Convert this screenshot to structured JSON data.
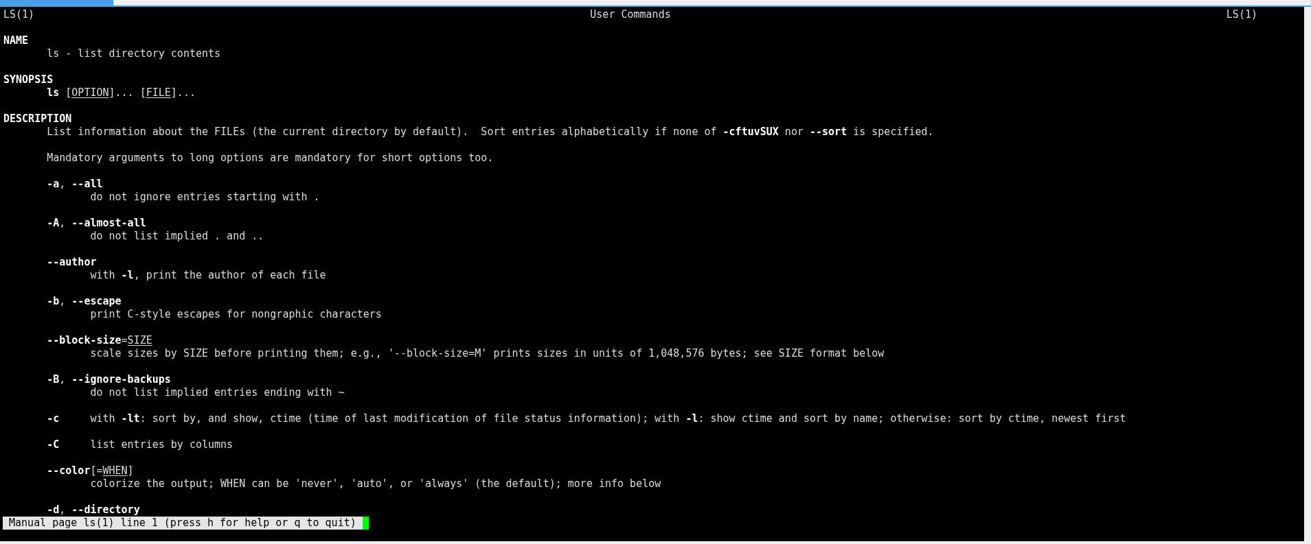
{
  "header": {
    "left": "LS(1)",
    "center": "User Commands",
    "right": "LS(1)"
  },
  "lines": [
    {
      "kind": "heading",
      "segments": [
        {
          "t": "NAME",
          "kind": "bold"
        }
      ]
    },
    {
      "kind": "text",
      "segments": [
        {
          "t": "ls - list directory contents",
          "kind": "plain"
        }
      ]
    },
    {
      "kind": "blank"
    },
    {
      "kind": "heading",
      "segments": [
        {
          "t": "SYNOPSIS",
          "kind": "bold"
        }
      ]
    },
    {
      "kind": "text",
      "segments": [
        {
          "t": "ls",
          "kind": "bold"
        },
        {
          "t": " [",
          "kind": "plain"
        },
        {
          "t": "OPTION",
          "kind": "underline"
        },
        {
          "t": "]... [",
          "kind": "plain"
        },
        {
          "t": "FILE",
          "kind": "underline"
        },
        {
          "t": "]...",
          "kind": "plain"
        }
      ]
    },
    {
      "kind": "blank"
    },
    {
      "kind": "heading",
      "segments": [
        {
          "t": "DESCRIPTION",
          "kind": "bold"
        }
      ]
    },
    {
      "kind": "text",
      "segments": [
        {
          "t": "List information about the FILEs (the current directory by default).  Sort entries alphabetically if none of ",
          "kind": "plain"
        },
        {
          "t": "-cftuvSUX",
          "kind": "bold"
        },
        {
          "t": " nor ",
          "kind": "plain"
        },
        {
          "t": "--sort",
          "kind": "bold"
        },
        {
          "t": " is specified.",
          "kind": "plain"
        }
      ]
    },
    {
      "kind": "blank"
    },
    {
      "kind": "text",
      "segments": [
        {
          "t": "Mandatory arguments to long options are mandatory for short options too.",
          "kind": "plain"
        }
      ]
    },
    {
      "kind": "blank"
    },
    {
      "kind": "text",
      "segments": [
        {
          "t": "-a",
          "kind": "bold"
        },
        {
          "t": ", ",
          "kind": "plain"
        },
        {
          "t": "--all",
          "kind": "bold"
        }
      ]
    },
    {
      "kind": "desc",
      "segments": [
        {
          "t": "do not ignore entries starting with .",
          "kind": "plain"
        }
      ]
    },
    {
      "kind": "blank"
    },
    {
      "kind": "text",
      "segments": [
        {
          "t": "-A",
          "kind": "bold"
        },
        {
          "t": ", ",
          "kind": "plain"
        },
        {
          "t": "--almost-all",
          "kind": "bold"
        }
      ]
    },
    {
      "kind": "desc",
      "segments": [
        {
          "t": "do not list implied . and ..",
          "kind": "plain"
        }
      ]
    },
    {
      "kind": "blank"
    },
    {
      "kind": "text",
      "segments": [
        {
          "t": "--author",
          "kind": "bold"
        }
      ]
    },
    {
      "kind": "desc",
      "segments": [
        {
          "t": "with ",
          "kind": "plain"
        },
        {
          "t": "-l",
          "kind": "bold"
        },
        {
          "t": ", print the author of each file",
          "kind": "plain"
        }
      ]
    },
    {
      "kind": "blank"
    },
    {
      "kind": "text",
      "segments": [
        {
          "t": "-b",
          "kind": "bold"
        },
        {
          "t": ", ",
          "kind": "plain"
        },
        {
          "t": "--escape",
          "kind": "bold"
        }
      ]
    },
    {
      "kind": "desc",
      "segments": [
        {
          "t": "print C-style escapes for nongraphic characters",
          "kind": "plain"
        }
      ]
    },
    {
      "kind": "blank"
    },
    {
      "kind": "text",
      "segments": [
        {
          "t": "--block-size",
          "kind": "bold"
        },
        {
          "t": "=",
          "kind": "plain"
        },
        {
          "t": "SIZE",
          "kind": "underline"
        }
      ]
    },
    {
      "kind": "desc",
      "segments": [
        {
          "t": "scale sizes by SIZE before printing them; e.g., '--block-size=M' prints sizes in units of 1,048,576 bytes; see SIZE format below",
          "kind": "plain"
        }
      ]
    },
    {
      "kind": "blank"
    },
    {
      "kind": "text",
      "segments": [
        {
          "t": "-B",
          "kind": "bold"
        },
        {
          "t": ", ",
          "kind": "plain"
        },
        {
          "t": "--ignore-backups",
          "kind": "bold"
        }
      ]
    },
    {
      "kind": "desc",
      "segments": [
        {
          "t": "do not list implied entries ending with ~",
          "kind": "plain"
        }
      ]
    },
    {
      "kind": "blank"
    },
    {
      "kind": "tagged",
      "tag": [
        {
          "t": "-c",
          "kind": "bold"
        }
      ],
      "segments": [
        {
          "t": "with ",
          "kind": "plain"
        },
        {
          "t": "-lt",
          "kind": "bold"
        },
        {
          "t": ": sort by, and show, ctime (time of last modification of file status information); with ",
          "kind": "plain"
        },
        {
          "t": "-l",
          "kind": "bold"
        },
        {
          "t": ": show ctime and sort by name; otherwise: sort by ctime, newest first",
          "kind": "plain"
        }
      ]
    },
    {
      "kind": "blank"
    },
    {
      "kind": "tagged",
      "tag": [
        {
          "t": "-C",
          "kind": "bold"
        }
      ],
      "segments": [
        {
          "t": "list entries by columns",
          "kind": "plain"
        }
      ]
    },
    {
      "kind": "blank"
    },
    {
      "kind": "text",
      "segments": [
        {
          "t": "--color",
          "kind": "bold"
        },
        {
          "t": "[=",
          "kind": "plain"
        },
        {
          "t": "WHEN",
          "kind": "underline"
        },
        {
          "t": "]",
          "kind": "plain"
        }
      ]
    },
    {
      "kind": "desc",
      "segments": [
        {
          "t": "colorize the output; WHEN can be 'never', 'auto', or 'always' (the default); more info below",
          "kind": "plain"
        }
      ]
    },
    {
      "kind": "blank"
    },
    {
      "kind": "text",
      "segments": [
        {
          "t": "-d",
          "kind": "bold"
        },
        {
          "t": ", ",
          "kind": "plain"
        },
        {
          "t": "--directory",
          "kind": "bold"
        }
      ]
    }
  ],
  "status_line": "Manual page ls(1) line 1 (press h for help or q to quit)"
}
